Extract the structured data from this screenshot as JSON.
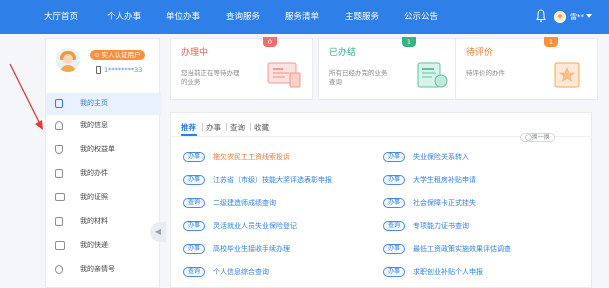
{
  "topnav": {
    "items": [
      "大厅首页",
      "个人办事",
      "单位办事",
      "查询服务",
      "服务清单",
      "主题服务",
      "公示公告"
    ],
    "username": "雷**"
  },
  "profile": {
    "verify_badge": "实人认证用户",
    "phone": "1********33"
  },
  "sidebar": {
    "items": [
      {
        "label": "我的主页",
        "icon": "home-icon"
      },
      {
        "label": "我的信息",
        "icon": "user-icon"
      },
      {
        "label": "我的权益单",
        "icon": "shield-icon"
      },
      {
        "label": "我的办件",
        "icon": "document-icon"
      },
      {
        "label": "我的证照",
        "icon": "id-card-icon"
      },
      {
        "label": "我的材料",
        "icon": "folder-icon"
      },
      {
        "label": "我的快递",
        "icon": "package-icon"
      },
      {
        "label": "我的亲情号",
        "icon": "family-icon"
      }
    ],
    "collapse": "◀"
  },
  "cards": [
    {
      "title": "办理中",
      "desc": "您当前正在等待办理的业务",
      "count": "0",
      "title_color": "#e8614f",
      "badge_color": "#f56c6c"
    },
    {
      "title": "已办结",
      "desc": "所有已经办完的业务查询",
      "count": "1",
      "title_color": "#2fb38a",
      "badge_color": "#36b37e"
    },
    {
      "title": "待评价",
      "desc": "待评价的办件",
      "count": "1",
      "title_color": "#f27830",
      "badge_color": "#ff8f3a"
    }
  ],
  "tabs": [
    "推荐",
    "办事",
    "查询",
    "收藏"
  ],
  "refresh": "◯换一换",
  "services_left": [
    {
      "tag": "办事",
      "text": "拖欠农民工工资线索投诉"
    },
    {
      "tag": "办事",
      "text": "江苏省（市级）技能大奖评选表彰申报"
    },
    {
      "tag": "查询",
      "text": "二级建造师成绩查询"
    },
    {
      "tag": "办事",
      "text": "灵活就业人员失业保险登记"
    },
    {
      "tag": "办事",
      "text": "高校毕业生接收手续办理"
    },
    {
      "tag": "查询",
      "text": "个人信息综合查询"
    }
  ],
  "services_right": [
    {
      "tag": "办事",
      "text": "失业保险关系转入"
    },
    {
      "tag": "办事",
      "text": "大学生租房补贴申请"
    },
    {
      "tag": "办事",
      "text": "社会保障卡正式挂失"
    },
    {
      "tag": "查询",
      "text": "专项能力证书查询"
    },
    {
      "tag": "办事",
      "text": "最低工资政策实施效果评估调查"
    },
    {
      "tag": "办事",
      "text": "求职创业补贴个人申报"
    }
  ],
  "colors": {
    "nav": "#2f7fe8",
    "accent": "#2f7fe8",
    "highlight": "#f27830",
    "arrow": "#e53935"
  }
}
